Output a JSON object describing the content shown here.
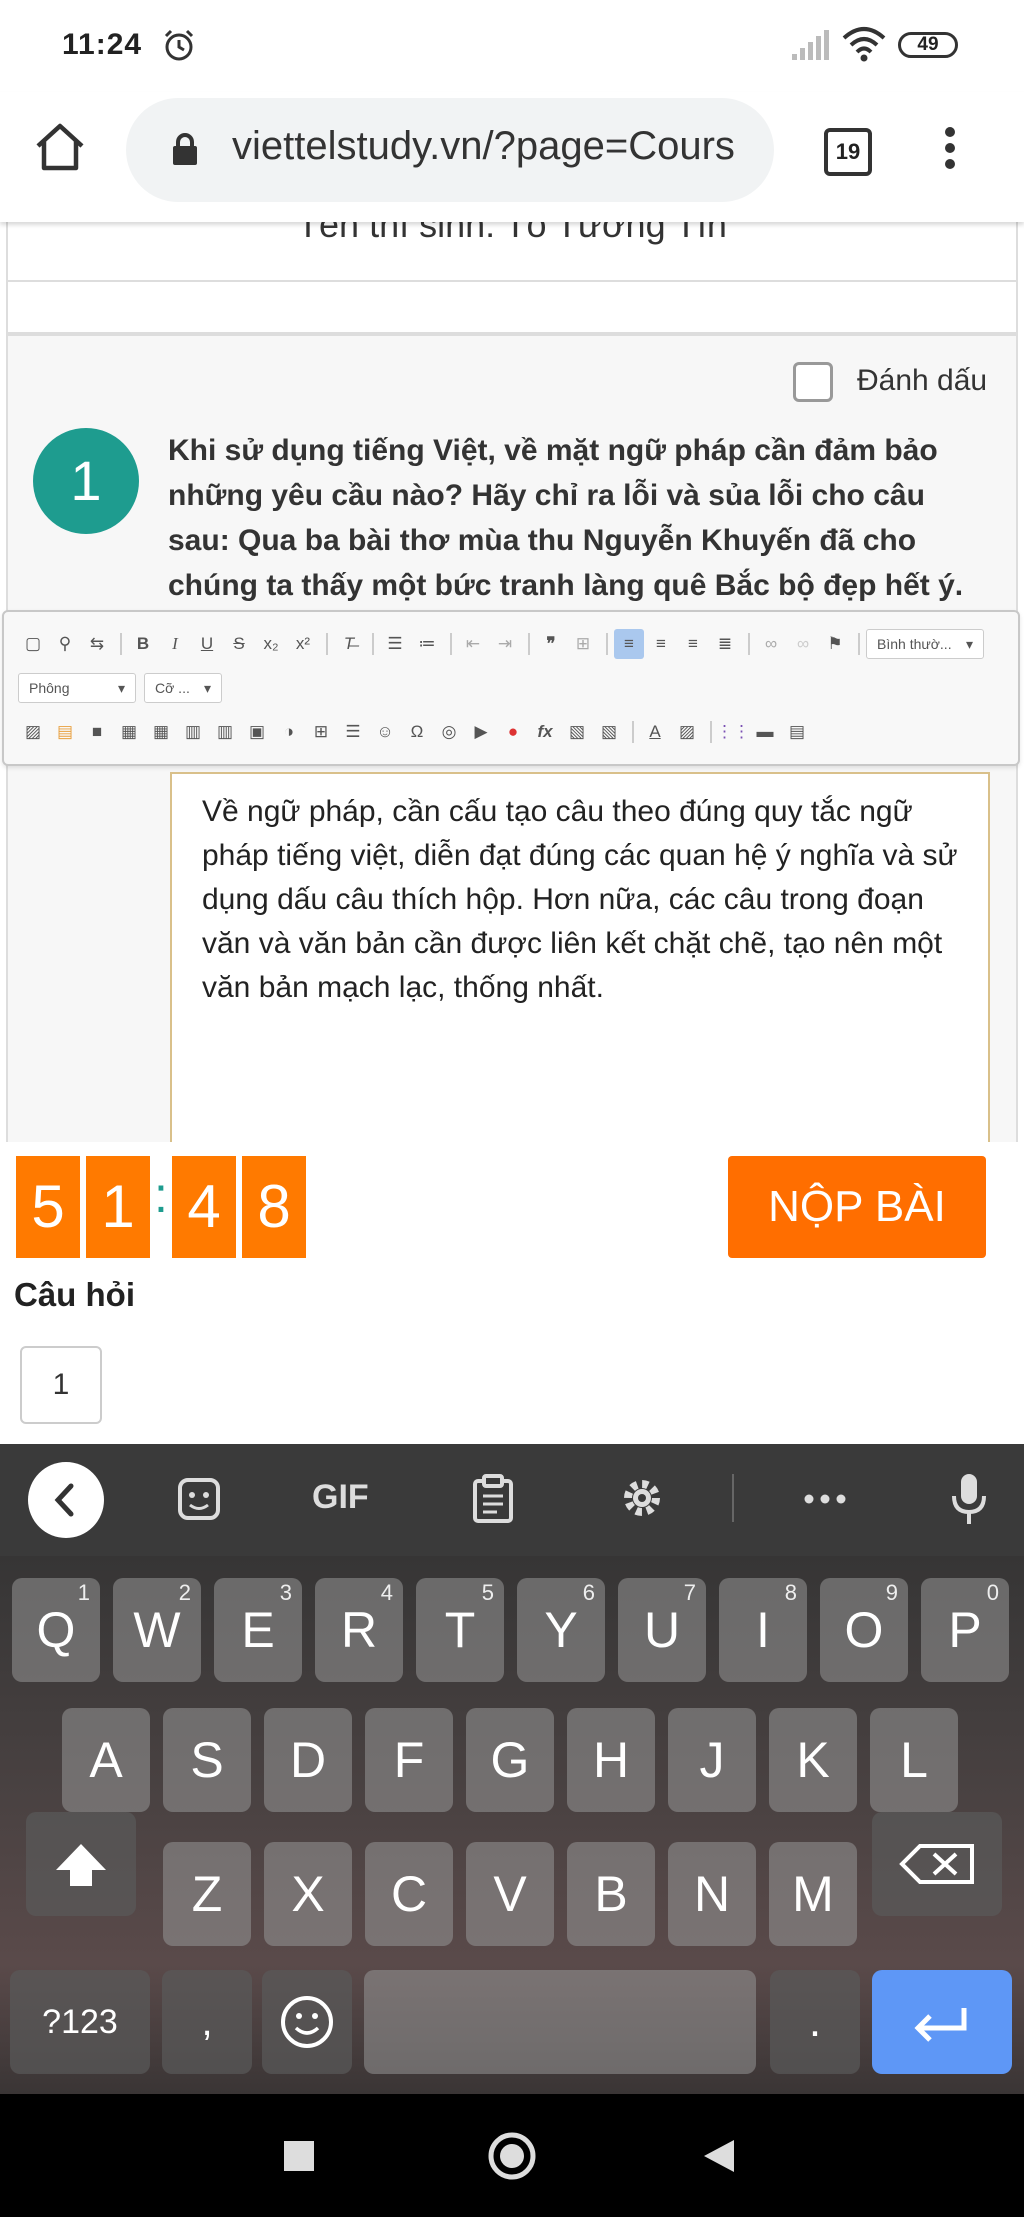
{
  "status_bar": {
    "time": "11:24",
    "battery": "49"
  },
  "browser": {
    "url": "viettelstudy.vn/?page=Cours",
    "tab_count": "19"
  },
  "exam": {
    "candidate_name": "Tên thí sinh: Tô Tường Tín",
    "mark_label": "Đánh dấu",
    "question_number": "1",
    "question_text": "Khi sử dụng tiếng Việt, về mặt ngữ pháp cần đảm bảo những yêu cầu nào? Hãy chỉ ra lỗi và sủa lỗi cho câu sau: Qua ba bài thơ mùa thu Nguyễn Khuyến đã cho chúng ta thấy một bức tranh làng quê Bắc bộ đẹp hết ý.",
    "answer_text": "Về ngữ pháp, cần cấu tạo câu theo đúng quy tắc ngữ pháp tiếng việt, diễn đạt đúng các quan hệ ý nghĩa và sử dụng dấu câu thích hộp. Hơn nữa, các câu trong đoạn văn và văn bản cần được liên kết chặt chẽ, tạo nên một văn bản mạch lạc, thống nhất."
  },
  "editor": {
    "format_select": "Bình thườ...",
    "font_select": "Phông",
    "size_select": "Cỡ ..."
  },
  "timer": {
    "d1": "5",
    "d2": "1",
    "colon": ":",
    "d3": "4",
    "d4": "8"
  },
  "submit_label": "NỘP BÀI",
  "question_nav": {
    "heading": "Câu hỏi",
    "items": [
      "1"
    ]
  },
  "keyboard": {
    "toolbar": {
      "gif": "GIF"
    },
    "row1": [
      {
        "k": "Q",
        "h": "1"
      },
      {
        "k": "W",
        "h": "2"
      },
      {
        "k": "E",
        "h": "3"
      },
      {
        "k": "R",
        "h": "4"
      },
      {
        "k": "T",
        "h": "5"
      },
      {
        "k": "Y",
        "h": "6"
      },
      {
        "k": "U",
        "h": "7"
      },
      {
        "k": "I",
        "h": "8"
      },
      {
        "k": "O",
        "h": "9"
      },
      {
        "k": "P",
        "h": "0"
      }
    ],
    "row2": [
      "A",
      "S",
      "D",
      "F",
      "G",
      "H",
      "J",
      "K",
      "L"
    ],
    "row3": [
      "Z",
      "X",
      "C",
      "V",
      "B",
      "N",
      "M"
    ],
    "symbols_key": "?123",
    "comma_key": ",",
    "period_key": "."
  }
}
